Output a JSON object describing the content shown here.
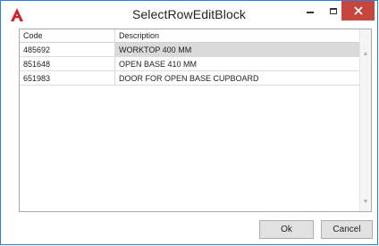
{
  "window": {
    "title": "SelectRowEditBlock",
    "icon": "autocad-icon",
    "controls": {
      "minimize": "minimize-icon",
      "maximize": "maximize-icon",
      "close": "close-icon"
    },
    "close_color": "#c7463c",
    "border_color": "#2b7de1"
  },
  "grid": {
    "columns": [
      "Code",
      "Description"
    ],
    "rows": [
      {
        "code": "485692",
        "description": "WORKTOP 400 MM"
      },
      {
        "code": "851648",
        "description": "OPEN BASE 410 MM"
      },
      {
        "code": "651983",
        "description": "DOOR FOR OPEN BASE CUPBOARD"
      }
    ],
    "selected_row": 0
  },
  "buttons": {
    "ok": "Ok",
    "cancel": "Cancel"
  }
}
